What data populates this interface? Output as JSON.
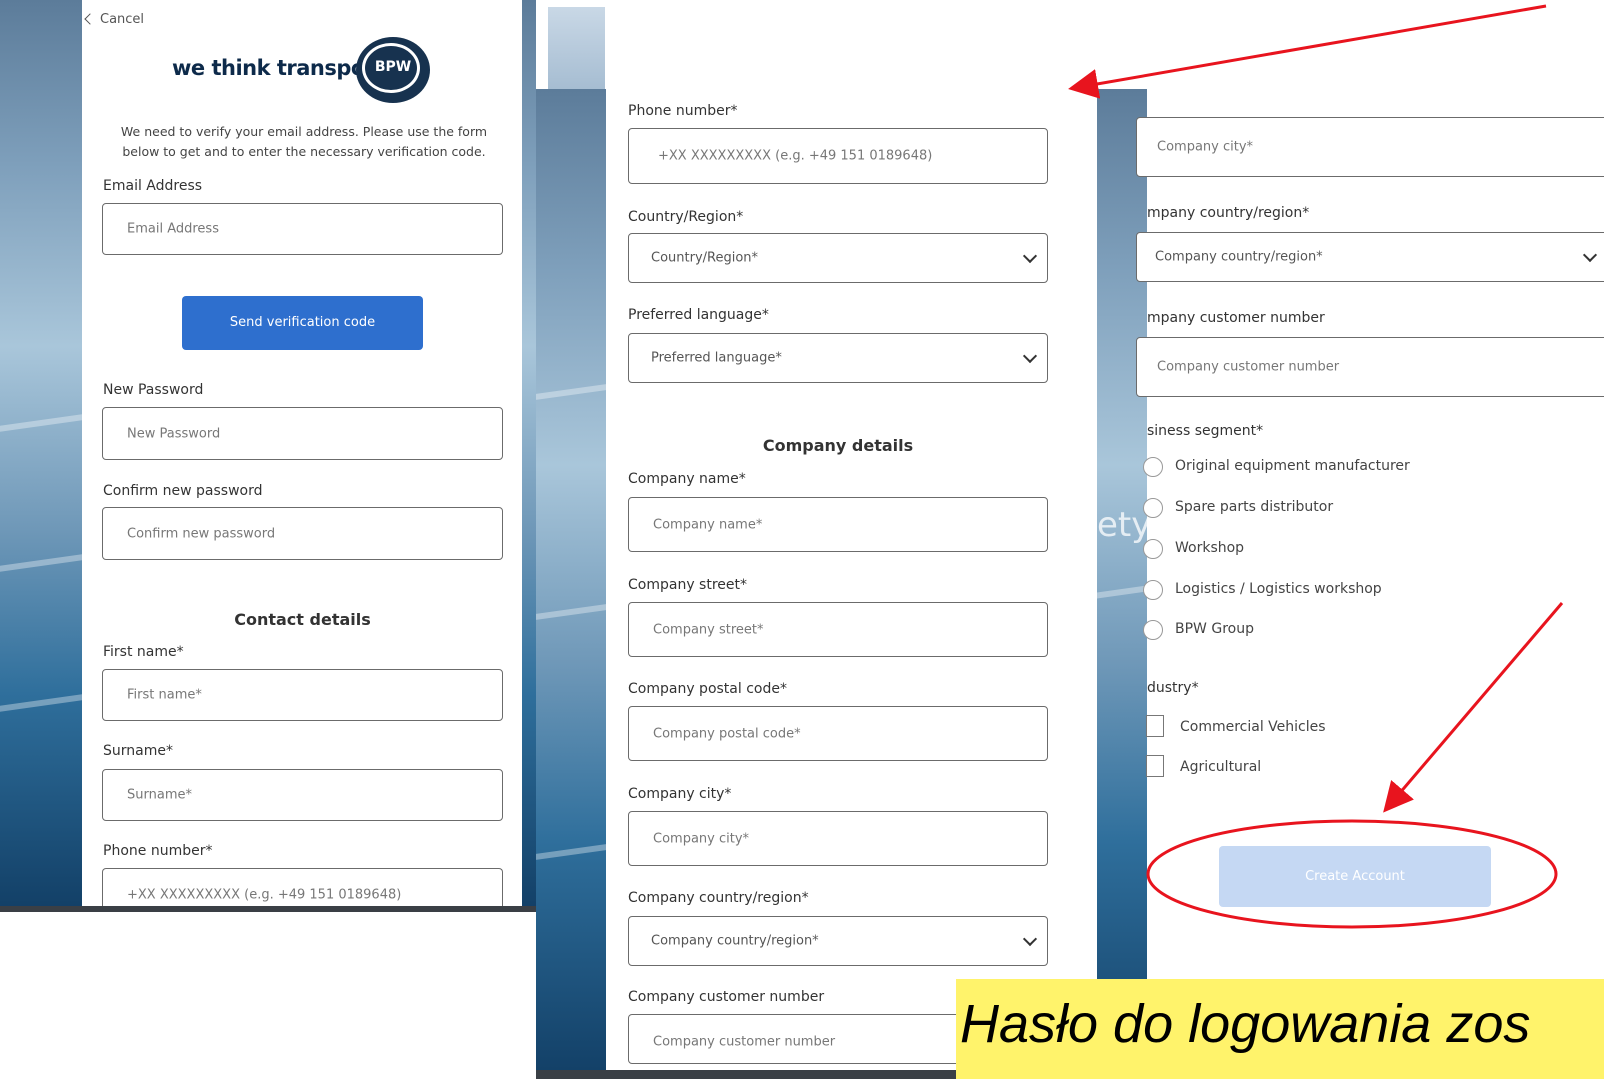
{
  "colors": {
    "primary_button": "#2e6fce",
    "disabled_button": "#c5d8f3",
    "annotation_red": "#e8141e",
    "banner_yellow": "#fff36b"
  },
  "left": {
    "cancel_label": "Cancel",
    "brand_text": "we think transport",
    "logo_text": "BPW",
    "intro_text": "We need to verify your email address. Please use the form below to get and to enter the necessary verification code.",
    "email_label": "Email Address",
    "email_placeholder": "Email Address",
    "send_code_label": "Send verification code",
    "new_password_label": "New Password",
    "new_password_placeholder": "New Password",
    "confirm_password_label": "Confirm new password",
    "confirm_password_placeholder": "Confirm new password",
    "contact_heading": "Contact details",
    "first_name_label": "First name*",
    "first_name_placeholder": "First name*",
    "surname_label": "Surname*",
    "surname_placeholder": "Surname*",
    "phone_label": "Phone number*",
    "phone_placeholder": "+XX XXXXXXXXX (e.g. +49 151 0189648)"
  },
  "middle": {
    "phone_label": "Phone number*",
    "phone_placeholder": "+XX XXXXXXXXX (e.g. +49 151 0189648)",
    "country_label": "Country/Region*",
    "country_value": "Country/Region*",
    "language_label": "Preferred language*",
    "language_value": "Preferred language*",
    "company_heading": "Company details",
    "company_name_label": "Company name*",
    "company_name_placeholder": "Company name*",
    "company_street_label": "Company street*",
    "company_street_placeholder": "Company street*",
    "company_postal_label": "Company postal code*",
    "company_postal_placeholder": "Company postal code*",
    "company_city_label": "Company city*",
    "company_city_placeholder": "Company city*",
    "company_country_label": "Company country/region*",
    "company_country_value": "Company country/region*",
    "company_customer_label": "Company customer number",
    "company_customer_placeholder": "Company customer number"
  },
  "right": {
    "company_city_placeholder": "Company city*",
    "company_country_label": "mpany country/region*",
    "company_country_value": "Company country/region*",
    "company_customer_label": "mpany customer number",
    "company_customer_placeholder": "Company customer number",
    "segment_label": "siness segment*",
    "segments": [
      "Original equipment manufacturer",
      "Spare parts distributor",
      "Workshop",
      "Logistics / Logistics workshop",
      "BPW Group"
    ],
    "industry_label": "dustry*",
    "industries": [
      "Commercial Vehicles",
      "Agricultural"
    ],
    "create_account_label": "Create Account"
  },
  "banner_text": "Hasło do logowania zos",
  "bg_fragment_text": "ety"
}
